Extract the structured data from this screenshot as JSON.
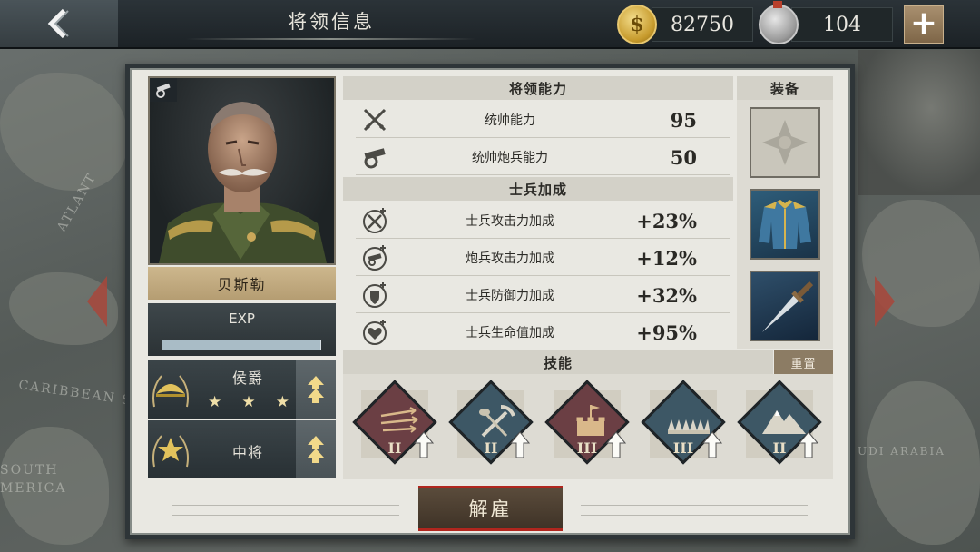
{
  "header": {
    "title": "将领信息",
    "gold_amount": "82750",
    "medal_amount": "104",
    "gold_icon_symbol": "$",
    "plus_label": "+"
  },
  "map_labels": [
    "ATLANT",
    "CARIBBEAN S",
    "SOUTH",
    "MERICA",
    "UDI ARABIA"
  ],
  "general": {
    "name": "贝斯勒",
    "exp_label": "EXP",
    "exp_fill": 1.0,
    "title_rank": "侯爵",
    "title_stars": 3,
    "military_rank": "中将"
  },
  "abilities": {
    "header": "将领能力",
    "rows": [
      {
        "icon": "crossed-swords-icon",
        "label": "统帅能力",
        "value": "95"
      },
      {
        "icon": "cannon-icon",
        "label": "统帅炮兵能力",
        "value": "50"
      }
    ]
  },
  "bonuses": {
    "header": "士兵加成",
    "rows": [
      {
        "icon": "attack-plus-icon",
        "label": "士兵攻击力加成",
        "value": "+23%"
      },
      {
        "icon": "artillery-plus-icon",
        "label": "炮兵攻击力加成",
        "value": "+12%"
      },
      {
        "icon": "shield-plus-icon",
        "label": "士兵防御力加成",
        "value": "+32%"
      },
      {
        "icon": "heart-plus-icon",
        "label": "士兵生命值加成",
        "value": "+95%"
      }
    ]
  },
  "equipment": {
    "header": "装备",
    "slots": [
      {
        "icon": "medal-cross-icon",
        "state": "empty"
      },
      {
        "icon": "uniform-coat-icon",
        "state": "equipped"
      },
      {
        "icon": "dagger-icon",
        "state": "equipped"
      }
    ]
  },
  "skills": {
    "header": "技能",
    "reset_label": "重置",
    "items": [
      {
        "icon": "arrows-volley-icon",
        "level": "II",
        "color": "#6b3f44"
      },
      {
        "icon": "pick-and-shovel-icon",
        "level": "II",
        "color": "#3d5765"
      },
      {
        "icon": "fortress-flag-icon",
        "level": "III",
        "color": "#6b3f44"
      },
      {
        "icon": "trench-spikes-icon",
        "level": "III",
        "color": "#3d5765"
      },
      {
        "icon": "mountain-icon",
        "level": "II",
        "color": "#3d5765"
      }
    ]
  },
  "footer": {
    "dismiss_label": "解雇"
  },
  "colors": {
    "accent_red": "#b0261e",
    "panel_bg": "#e9e8e2",
    "name_plate": "#c4ac80"
  }
}
